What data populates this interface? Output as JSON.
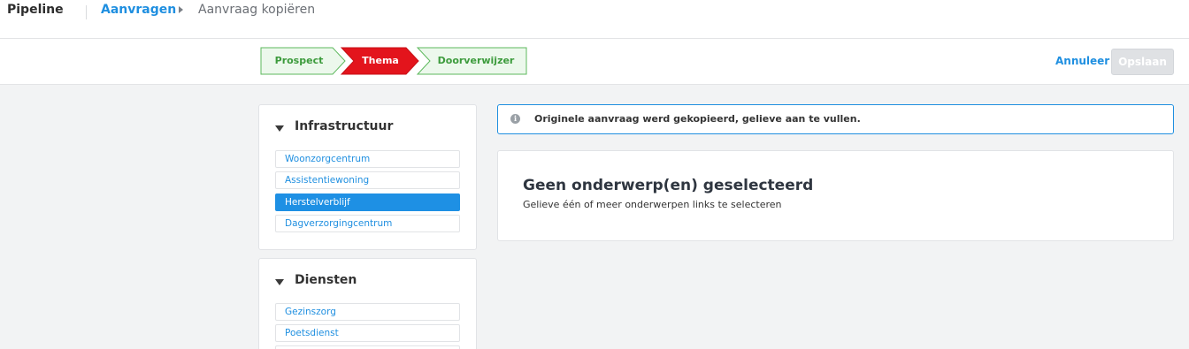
{
  "header": {
    "brand": "Pipeline",
    "breadcrumb_link": "Aanvragen",
    "breadcrumb_current": "Aanvraag kopiëren"
  },
  "steps": [
    {
      "label": "Prospect",
      "state": "done"
    },
    {
      "label": "Thema",
      "state": "active"
    },
    {
      "label": "Doorverwijzer",
      "state": "done"
    }
  ],
  "actions": {
    "cancel_label": "Annuleer",
    "save_label": "Opslaan",
    "save_disabled": true
  },
  "categories": [
    {
      "title": "Infrastructuur",
      "expanded": true,
      "items": [
        {
          "label": "Woonzorgcentrum",
          "selected": false
        },
        {
          "label": "Assistentiewoning",
          "selected": false
        },
        {
          "label": "Herstelverblijf",
          "selected": true
        },
        {
          "label": "Dagverzorgingcentrum",
          "selected": false
        }
      ]
    },
    {
      "title": "Diensten",
      "expanded": true,
      "items": [
        {
          "label": "Gezinszorg",
          "selected": false
        },
        {
          "label": "Poetsdienst",
          "selected": false
        }
      ]
    }
  ],
  "alert": {
    "text": "Originele aanvraag werd gekopieerd, gelieve aan te vullen."
  },
  "main": {
    "title": "Geen onderwerp(en) geselecteerd",
    "subtitle": "Gelieve één of meer onderwerpen links te selecteren"
  },
  "colors": {
    "accent_blue": "#1f8fe0",
    "step_done_border": "#5cb85c",
    "step_done_fill": "#ecf8ec",
    "step_done_text": "#3c9b3c",
    "step_active_fill": "#e3141c",
    "selected_item": "#1e90e4"
  }
}
